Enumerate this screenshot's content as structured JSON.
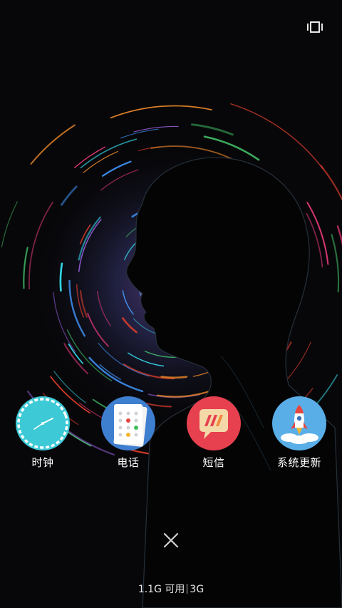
{
  "apps": [
    {
      "label": "时钟",
      "icon": "clock-icon",
      "color": "#3dc9d6"
    },
    {
      "label": "电话",
      "icon": "phone-dialpad-icon",
      "color": "#3f7fd0"
    },
    {
      "label": "短信",
      "icon": "message-icon",
      "color": "#e7404f"
    },
    {
      "label": "系统更新",
      "icon": "rocket-icon",
      "color": "#5aaee8"
    }
  ],
  "memory": {
    "available": "1.1G 可用",
    "total": "3G"
  },
  "controls": {
    "close_icon": "close-icon",
    "multiwindow_icon": "multi-window-icon"
  }
}
